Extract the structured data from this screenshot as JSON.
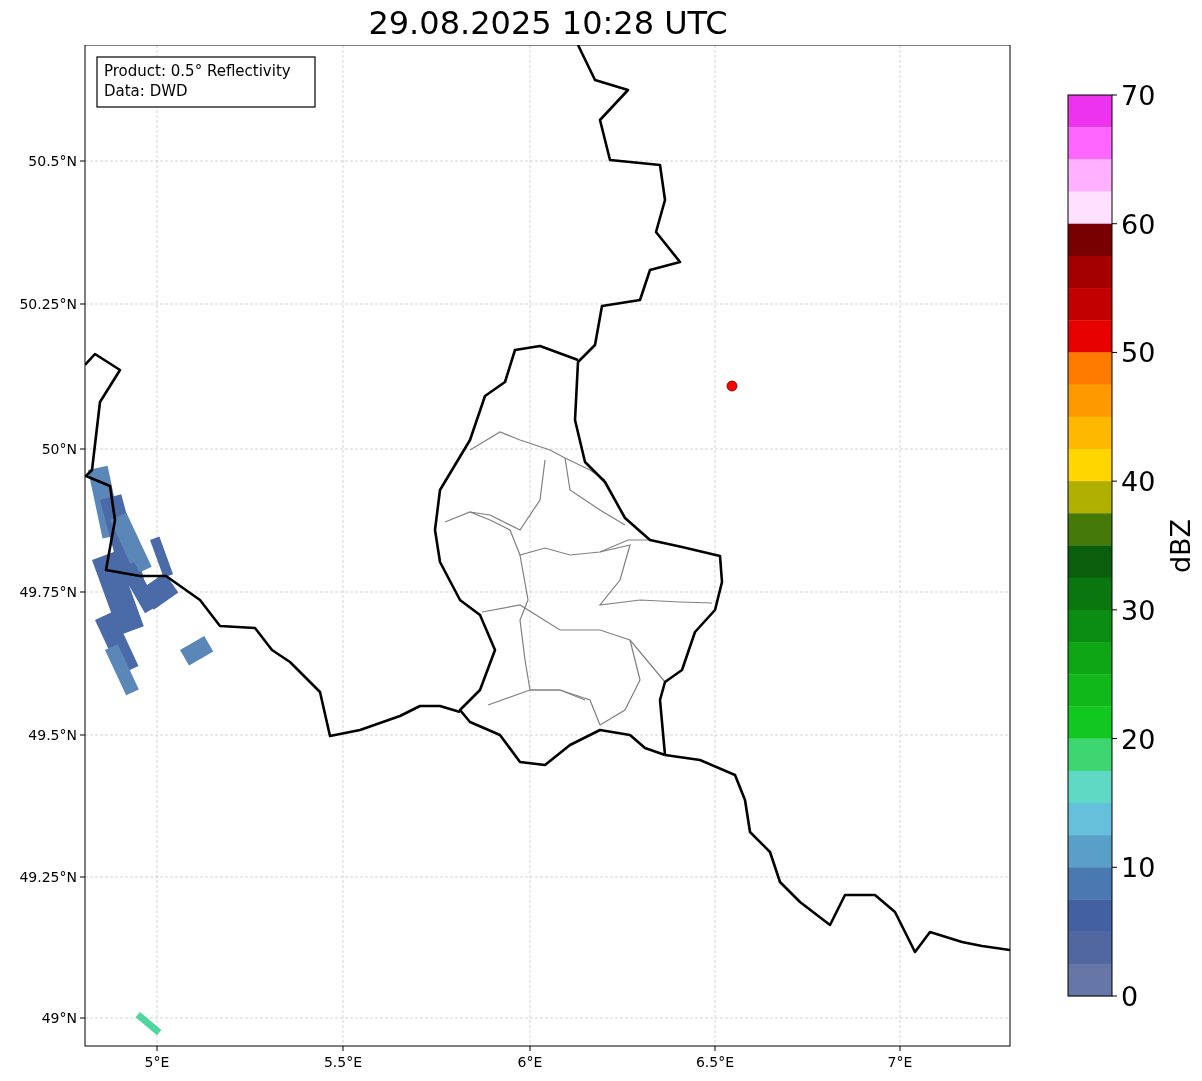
{
  "title": "29.08.2025 10:28 UTC",
  "info_box": [
    "Product: 0.5° Reflectivity",
    "Data: DWD"
  ],
  "lat_ticks": [
    "50.5°N",
    "50.25°N",
    "50°N",
    "49.75°N",
    "49.5°N",
    "49.25°N",
    "49°N"
  ],
  "lon_ticks": [
    "5°E",
    "5.5°E",
    "6°E",
    "6.5°E",
    "7°E"
  ],
  "colorbar": {
    "label": "dBZ",
    "ticks": [
      "70",
      "60",
      "50",
      "40",
      "30",
      "20",
      "10",
      "0"
    ],
    "segments": [
      {
        "color": "#ee33ee"
      },
      {
        "color": "#ff66ff"
      },
      {
        "color": "#ffb0ff"
      },
      {
        "color": "#ffe0ff"
      },
      {
        "color": "#780000"
      },
      {
        "color": "#a40000"
      },
      {
        "color": "#c20000"
      },
      {
        "color": "#e60000"
      },
      {
        "color": "#ff7b00"
      },
      {
        "color": "#ff9900"
      },
      {
        "color": "#ffb800"
      },
      {
        "color": "#ffd600"
      },
      {
        "color": "#b0b000"
      },
      {
        "color": "#457a08"
      },
      {
        "color": "#0a5e0c"
      },
      {
        "color": "#0a7610"
      },
      {
        "color": "#0b8c12"
      },
      {
        "color": "#0ea614"
      },
      {
        "color": "#10b81a"
      },
      {
        "color": "#10c820"
      },
      {
        "color": "#3dd671"
      },
      {
        "color": "#5fd8c4"
      },
      {
        "color": "#65c0dc"
      },
      {
        "color": "#5a9fc8"
      },
      {
        "color": "#4a78b0"
      },
      {
        "color": "#4360a0"
      },
      {
        "color": "#5167a0"
      },
      {
        "color": "#6676a6"
      }
    ]
  }
}
